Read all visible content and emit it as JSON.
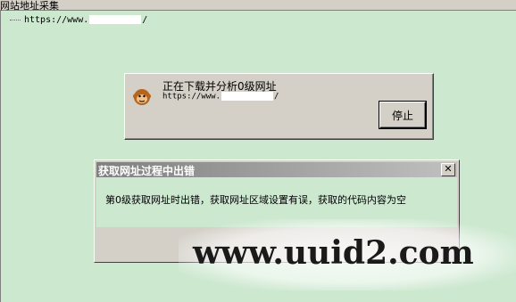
{
  "window": {
    "title": "网站地址采集"
  },
  "tree": {
    "url_prefix": "https://www.",
    "url_suffix": "/"
  },
  "progress_dialog": {
    "message": "正在下载并分析0级网址",
    "url_prefix": "https://www.",
    "url_suffix": "/",
    "stop_label": "停止",
    "icon": "monkey-icon"
  },
  "error_dialog": {
    "title": "获取网址过程中出错",
    "close_label": "✕",
    "message": "第0级获取网址时出错，获取网址区域设置有误，获取的代码内容为空"
  },
  "watermark": "www.uuid2.com",
  "colors": {
    "background": "#cce8cf",
    "dialog": "#d4d0c8",
    "titlebar": "#808080"
  }
}
